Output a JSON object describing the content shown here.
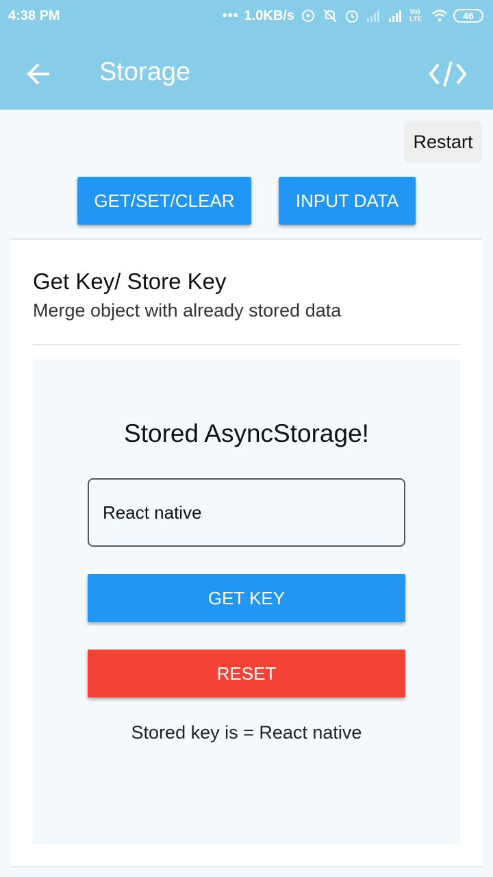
{
  "status_bar": {
    "time": "4:38 PM",
    "dots": "•••",
    "network_speed": "1.0KB/s",
    "volte_label": "Vo) LTE",
    "battery": "46"
  },
  "toolbar": {
    "back_icon": "arrow-left-icon",
    "title": "Storage",
    "code_icon": "code-icon"
  },
  "restart_label": "Restart",
  "tabs": [
    {
      "label": "GET/SET/CLEAR"
    },
    {
      "label": "INPUT DATA"
    }
  ],
  "card": {
    "title": "Get Key/ Store Key",
    "subtitle": "Merge object with already stored data",
    "demo": {
      "heading": "Stored AsyncStorage!",
      "input_value": "React native",
      "get_key_label": "GET KEY",
      "reset_label": "RESET",
      "result": "Stored key is = React native"
    }
  },
  "colors": {
    "appbar": "#87cdea",
    "primary": "#2196f3",
    "danger": "#f44336",
    "background": "#f3f9fd"
  }
}
